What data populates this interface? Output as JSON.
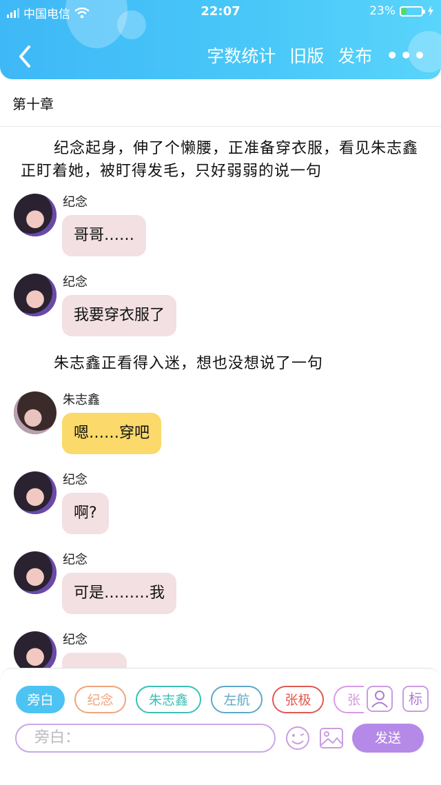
{
  "status_bar": {
    "carrier": "中国电信",
    "time": "22:07",
    "battery_percent": "23%"
  },
  "nav": {
    "word_count": "字数统计",
    "old_version": "旧版",
    "publish": "发布",
    "more": "•••"
  },
  "chapter_title": "第十章",
  "story": {
    "narration_1": "纪念起身，伸了个懒腰，正准备穿衣服，看见朱志鑫正盯着她，被盯得发毛，只好弱弱的说一句",
    "narration_2": "朱志鑫正看得入迷，想也没想说了一句",
    "messages": [
      {
        "name": "纪念",
        "text": "哥哥……"
      },
      {
        "name": "纪念",
        "text": "我要穿衣服了"
      },
      {
        "name": "朱志鑫",
        "text": "嗯……穿吧"
      },
      {
        "name": "纪念",
        "text": "啊?"
      },
      {
        "name": "纪念",
        "text": "可是………我"
      },
      {
        "name": "纪念",
        "text": ""
      }
    ]
  },
  "composer": {
    "roles": [
      "旁白",
      "纪念",
      "朱志鑫",
      "左航",
      "张极",
      "张"
    ],
    "role_colors": [
      "#4cc3f3",
      "#f0a47a",
      "#3bbfb3",
      "#5aa9c7",
      "#e0584f",
      "#d69ae6"
    ],
    "mark_label": "标",
    "input_placeholder": "旁白：",
    "send_label": "发送"
  }
}
